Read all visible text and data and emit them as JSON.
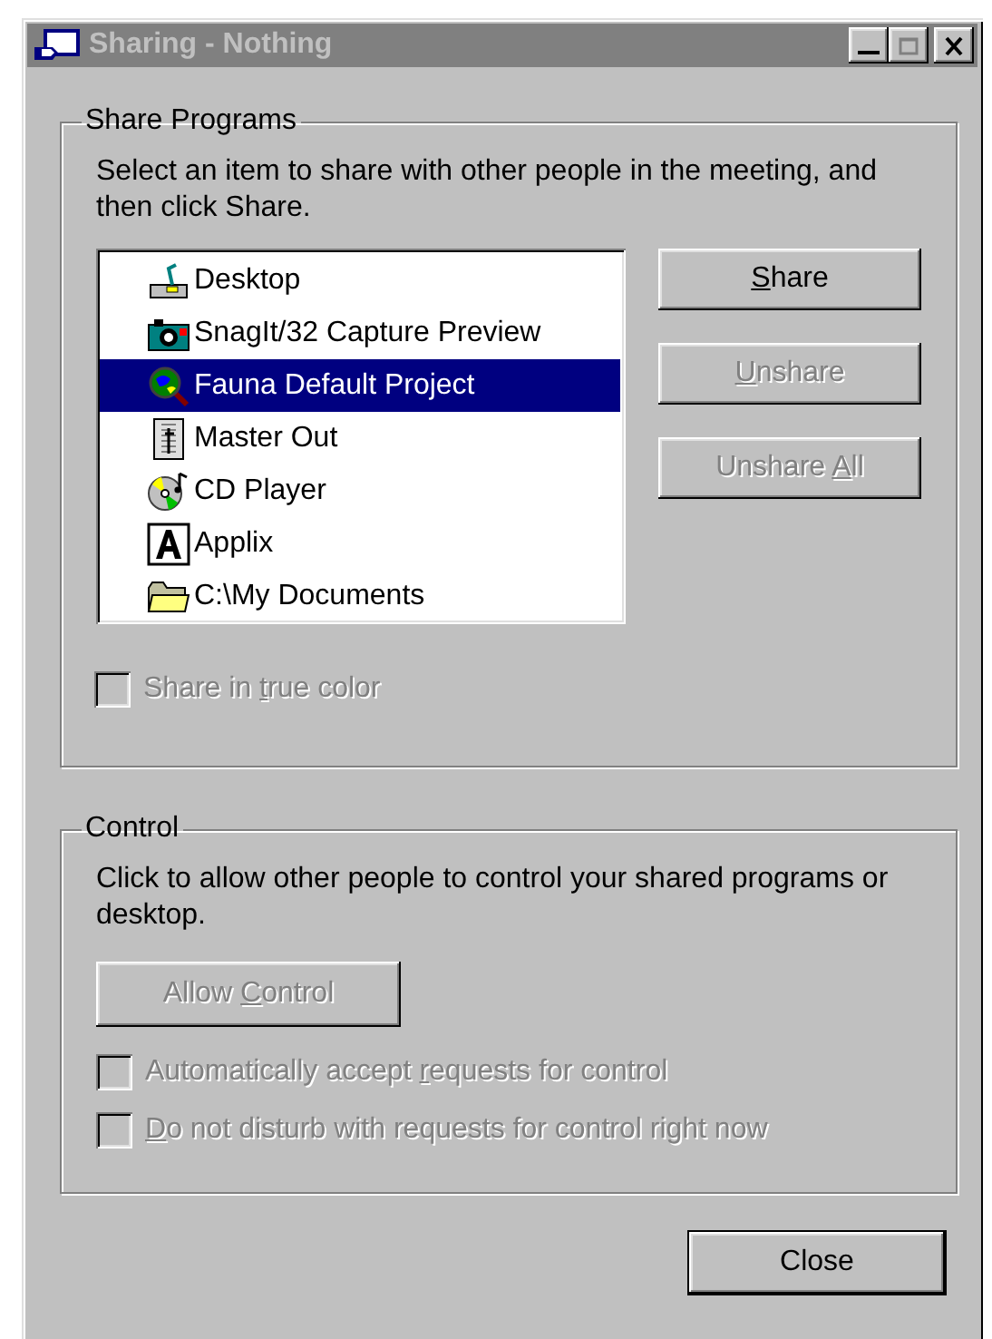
{
  "window": {
    "title": "Sharing - Nothing",
    "active": false
  },
  "share_programs": {
    "title": "Share Programs",
    "instructions": "Select an item to share with other people in the meeting, and then click Share.",
    "items": [
      {
        "label": "Desktop",
        "kind": "desktop",
        "selected": false
      },
      {
        "label": "SnagIt/32 Capture Preview",
        "kind": "camera",
        "selected": false
      },
      {
        "label": "Fauna Default Project",
        "kind": "globe",
        "selected": true
      },
      {
        "label": "Master Out",
        "kind": "document",
        "selected": false
      },
      {
        "label": "CD Player",
        "kind": "cd",
        "selected": false
      },
      {
        "label": "Applix",
        "kind": "letter",
        "selected": false
      },
      {
        "label": "C:\\My Documents",
        "kind": "folder",
        "selected": false
      }
    ],
    "buttons": [
      {
        "label": {
          "key": "S",
          "post": "hare"
        },
        "disabled": false
      },
      {
        "label": {
          "key": "U",
          "post": "nshare"
        },
        "disabled": true
      },
      {
        "label": {
          "pre": "Unshare ",
          "key": "A",
          "post": "ll"
        },
        "disabled": true
      }
    ],
    "checkbox": {
      "label": {
        "pre": "Share in ",
        "key": "t",
        "post": "rue color"
      },
      "checked": false,
      "disabled": true
    }
  },
  "control": {
    "title": "Control",
    "instructions": "Click to allow other people to control your shared programs or desktop.",
    "button": {
      "label": {
        "pre": "Allow ",
        "key": "C",
        "post": "ontrol"
      },
      "disabled": true
    },
    "checkboxes": [
      {
        "label": {
          "pre": "Automatically accept ",
          "key": "r",
          "post": "equests for control"
        },
        "checked": false,
        "disabled": true
      },
      {
        "label": {
          "key": "D",
          "post": "o not disturb with requests for control right now"
        },
        "checked": false,
        "disabled": true
      }
    ]
  },
  "footer": {
    "button": {
      "label": {
        "pre": "Close"
      },
      "disabled": false,
      "default": true
    }
  }
}
